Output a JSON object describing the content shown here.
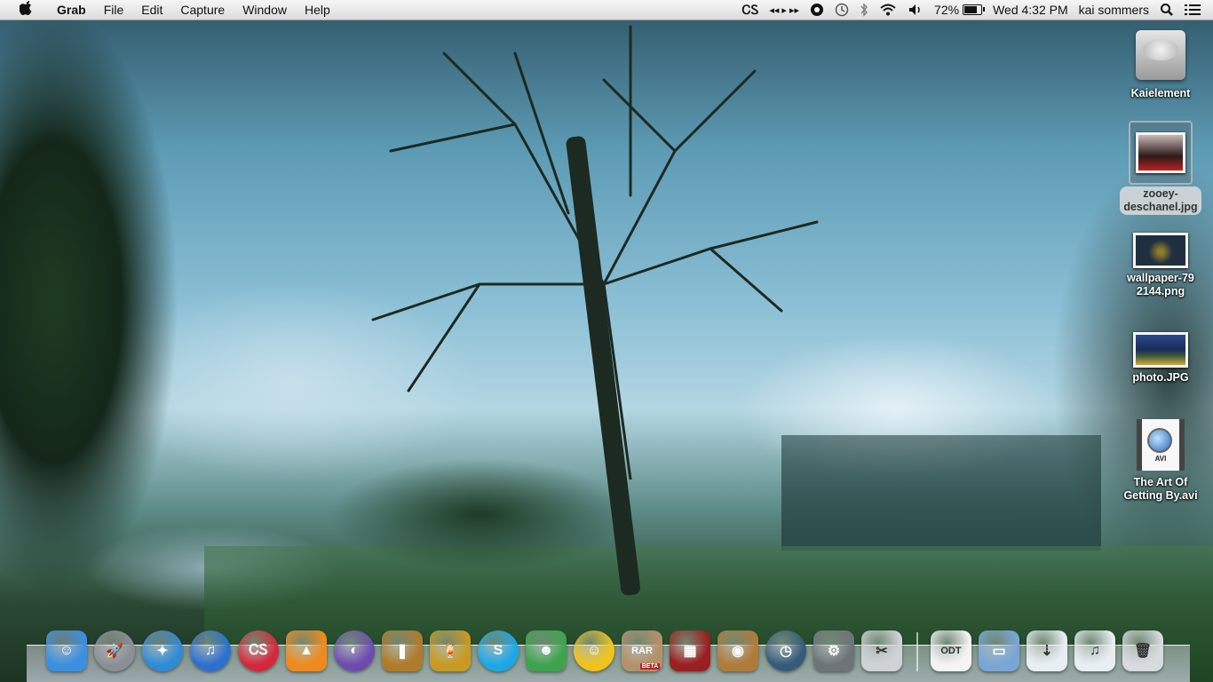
{
  "menubar": {
    "app_name": "Grab",
    "menus": [
      "File",
      "Edit",
      "Capture",
      "Window",
      "Help"
    ],
    "status": {
      "lastfm_glyph": "ᏟᏚ",
      "media_controls": "◂◂ ▸ ▸▸",
      "battery_percent": "72%",
      "battery_level": 0.72,
      "clock": "Wed 4:32 PM",
      "user": "kai sommers"
    }
  },
  "desktop": {
    "icons": [
      {
        "label": "Kaielement",
        "kind": "hard-drive"
      },
      {
        "label": "zooey-\ndeschanel.jpg",
        "kind": "image",
        "selected": true
      },
      {
        "label": "wallpaper-79\n2144.png",
        "kind": "image"
      },
      {
        "label": "photo.JPG",
        "kind": "image"
      },
      {
        "label": "The Art Of\nGetting By.avi",
        "kind": "movie",
        "badge": "AVI"
      }
    ]
  },
  "dock": {
    "apps": [
      {
        "name": "finder",
        "glyph": "☺",
        "color": "#3a8fe0"
      },
      {
        "name": "launchpad",
        "glyph": "🚀",
        "color": "#8a8f96"
      },
      {
        "name": "safari",
        "glyph": "✦",
        "color": "#2f8bd6"
      },
      {
        "name": "itunes",
        "glyph": "♫",
        "color": "#2b6fd1"
      },
      {
        "name": "lastfm",
        "glyph": "ᏟᏚ",
        "color": "#d5263a"
      },
      {
        "name": "vlc",
        "glyph": "▲",
        "color": "#f08a1c"
      },
      {
        "name": "bittorrent",
        "glyph": "◐",
        "color": "#6c4ab0"
      },
      {
        "name": "utility",
        "glyph": "❚",
        "color": "#b07a2a"
      },
      {
        "name": "adium",
        "glyph": "🍹",
        "color": "#c89a22"
      },
      {
        "name": "skype",
        "glyph": "S",
        "color": "#1aa7e8"
      },
      {
        "name": "messenger",
        "glyph": "☻",
        "color": "#3fa34d"
      },
      {
        "name": "yahoo-messenger",
        "glyph": "☺",
        "color": "#f2c21a"
      },
      {
        "name": "unrar",
        "glyph": "RAR",
        "color": "#b5906a",
        "badge": "BETA"
      },
      {
        "name": "photo-booth",
        "glyph": "▦",
        "color": "#9a1f1f"
      },
      {
        "name": "image-capture",
        "glyph": "◉",
        "color": "#b07a3a"
      },
      {
        "name": "time-machine",
        "glyph": "◷",
        "color": "#355a7a"
      },
      {
        "name": "system-preferences",
        "glyph": "⚙",
        "color": "#6e7378"
      },
      {
        "name": "scissors-tool",
        "glyph": "✂",
        "color": "#cfd3d6"
      }
    ],
    "docs": [
      {
        "name": "odt-document",
        "glyph": "ODT",
        "color": "#f4f4f4"
      },
      {
        "name": "folder",
        "glyph": "▭",
        "color": "#7aa6d6"
      },
      {
        "name": "downloads-stack",
        "glyph": "⇣",
        "color": "#e9eef3"
      },
      {
        "name": "music-stack",
        "glyph": "♫",
        "color": "#e9eef3"
      },
      {
        "name": "trash",
        "glyph": "🗑",
        "color": "#d7dade"
      }
    ]
  }
}
